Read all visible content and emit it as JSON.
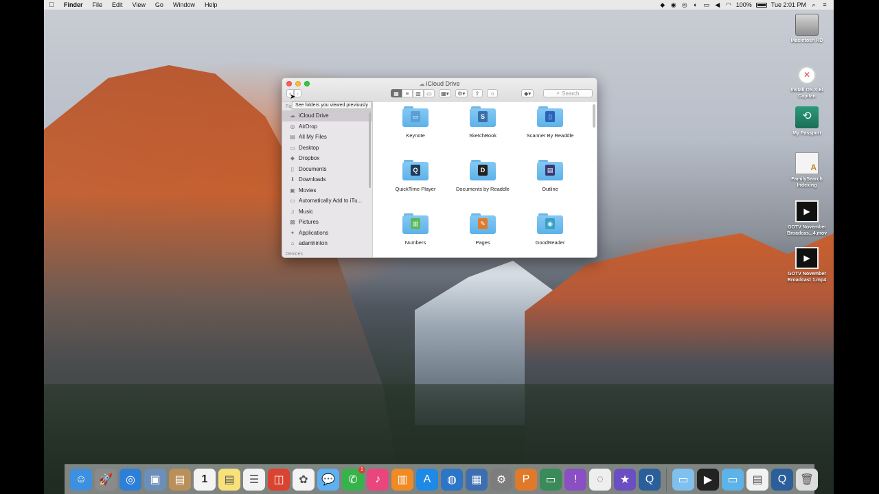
{
  "menubar": {
    "apple_icon": "apple-logo-icon",
    "items": [
      "Finder",
      "File",
      "Edit",
      "View",
      "Go",
      "Window",
      "Help"
    ],
    "battery": "100%",
    "clock": "Tue 2:01 PM"
  },
  "window": {
    "title": "iCloud Drive",
    "tooltip": "See folders you viewed previously",
    "search_placeholder": "Search",
    "sidebar_section_top": "Fa",
    "sidebar_section_devices": "Devices",
    "sidebar_items": [
      {
        "label": "iCloud Drive",
        "icon": "cloud-icon"
      },
      {
        "label": "AirDrop",
        "icon": "airdrop-icon"
      },
      {
        "label": "All My Files",
        "icon": "all-files-icon"
      },
      {
        "label": "Desktop",
        "icon": "desktop-icon"
      },
      {
        "label": "Dropbox",
        "icon": "dropbox-icon"
      },
      {
        "label": "Documents",
        "icon": "documents-icon"
      },
      {
        "label": "Downloads",
        "icon": "downloads-icon"
      },
      {
        "label": "Movies",
        "icon": "movies-icon"
      },
      {
        "label": "Automatically Add to iTu...",
        "icon": "folder-icon"
      },
      {
        "label": "Music",
        "icon": "music-icon"
      },
      {
        "label": "Pictures",
        "icon": "pictures-icon"
      },
      {
        "label": "Applications",
        "icon": "applications-icon"
      },
      {
        "label": "adamhinton",
        "icon": "home-icon"
      }
    ],
    "files": [
      {
        "label": "Keynote",
        "badge_color": "#5a9fd6"
      },
      {
        "label": "SketchBook",
        "badge_color": "#3b6fa8"
      },
      {
        "label": "Scanner By Readdle",
        "badge_color": "#2a63b8"
      },
      {
        "label": "QuickTime Player",
        "badge_color": "#1f3c5a"
      },
      {
        "label": "Documents by Readdle",
        "badge_color": "#222222"
      },
      {
        "label": "Outline",
        "badge_color": "#3a3a78"
      },
      {
        "label": "Numbers",
        "badge_color": "#5cb85c"
      },
      {
        "label": "Pages",
        "badge_color": "#e07b2e"
      },
      {
        "label": "GoodReader",
        "badge_color": "#3aa0c8"
      }
    ]
  },
  "desktop_icons": [
    {
      "label": "Macintosh HD"
    },
    {
      "label": "Install OS X El Capitan"
    },
    {
      "label": "My Passport"
    },
    {
      "label": "FamilySearch Indexing"
    },
    {
      "label": "GOTV November Broadcas...4.mov"
    },
    {
      "label": "GOTV November Broadcast 1.mp4"
    }
  ],
  "dock": {
    "mail_badge": "1",
    "calendar_day": "1",
    "apps": [
      "finder-icon",
      "launchpad-icon",
      "safari-icon",
      "preview-icon",
      "contacts-icon",
      "calendar-icon",
      "notes-icon",
      "reminders-icon",
      "photo-booth-icon",
      "photos-icon",
      "messages-icon",
      "facetime-icon",
      "itunes-icon",
      "ibooks-icon",
      "app-store-icon",
      "globe-icon",
      "keynote-icon",
      "system-preferences-icon",
      "app-icon",
      "screen-app-icon",
      "help-icon",
      "spinner-icon",
      "imovie-icon",
      "quicktime-icon"
    ],
    "right": [
      "folder-icon",
      "movie-file-icon",
      "folder-icon",
      "document-icon",
      "quicktime-file-icon",
      "trash-icon"
    ]
  }
}
